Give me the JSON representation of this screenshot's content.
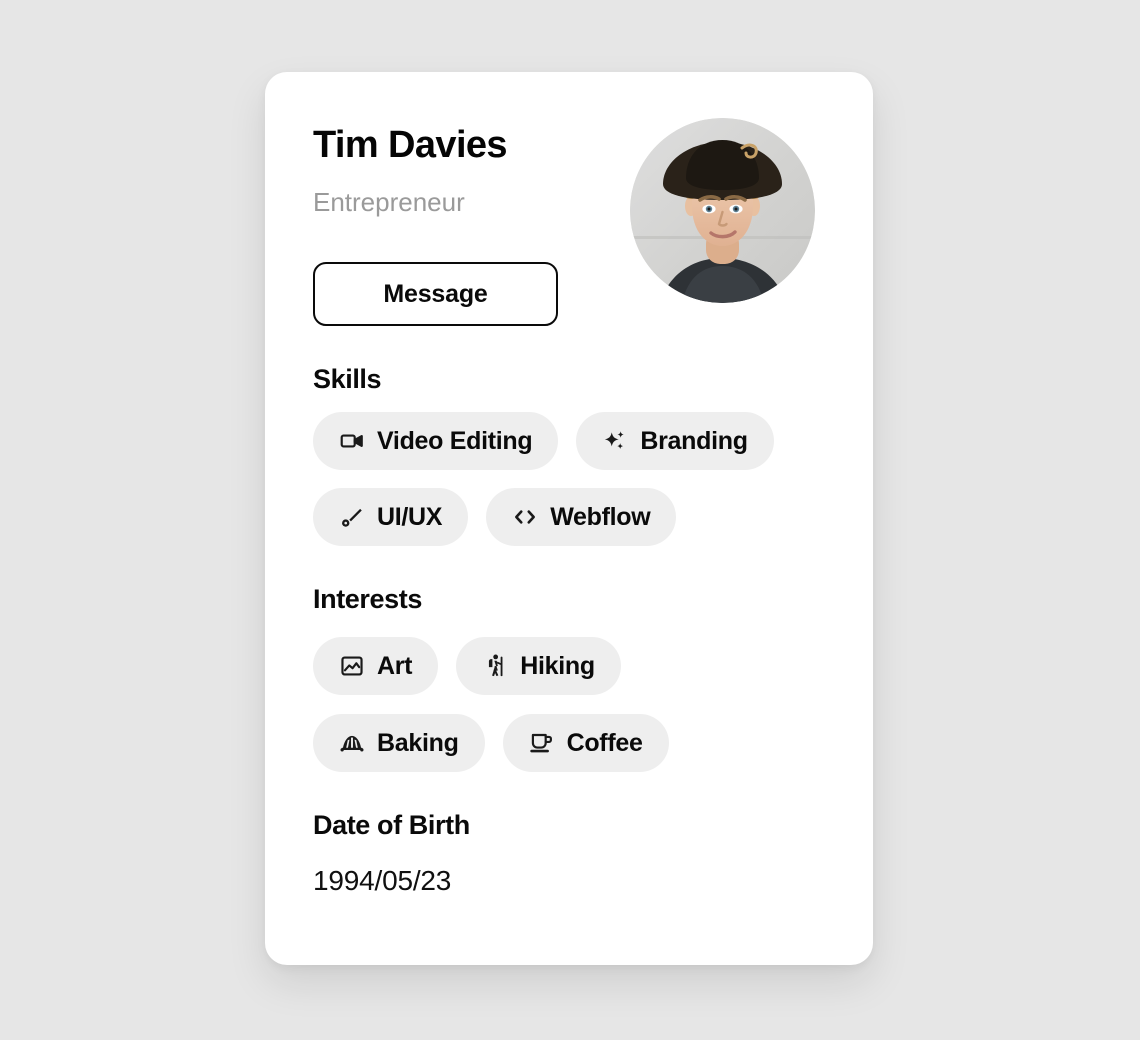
{
  "theme": {
    "page_background": "#e6e6e6",
    "card_background": "#ffffff",
    "chip_background": "#eeeeee",
    "text_primary": "#0a0a0a",
    "text_muted": "#9a9a9a"
  },
  "profile": {
    "name": "Tim Davies",
    "role": "Entrepreneur",
    "avatar_alt": "portrait of a young man with curly blond hair wearing a dark wide-brimmed hat",
    "avatar_icon": "avatar-photo"
  },
  "actions": {
    "message_label": "Message"
  },
  "skills": {
    "title": "Skills",
    "rows": [
      [
        {
          "label": "Video Editing",
          "icon": "video-camera-icon"
        },
        {
          "label": "Branding",
          "icon": "sparkles-icon"
        }
      ],
      [
        {
          "label": "UI/UX",
          "icon": "paintbrush-icon"
        },
        {
          "label": "Webflow",
          "icon": "code-brackets-icon"
        }
      ]
    ]
  },
  "interests": {
    "title": "Interests",
    "rows": [
      [
        {
          "label": "Art",
          "icon": "image-icon"
        },
        {
          "label": "Hiking",
          "icon": "hiking-person-icon"
        }
      ],
      [
        {
          "label": "Baking",
          "icon": "croissant-icon"
        },
        {
          "label": "Coffee",
          "icon": "coffee-cup-icon"
        }
      ]
    ]
  },
  "date_of_birth": {
    "title": "Date of Birth",
    "value": "1994/05/23"
  }
}
